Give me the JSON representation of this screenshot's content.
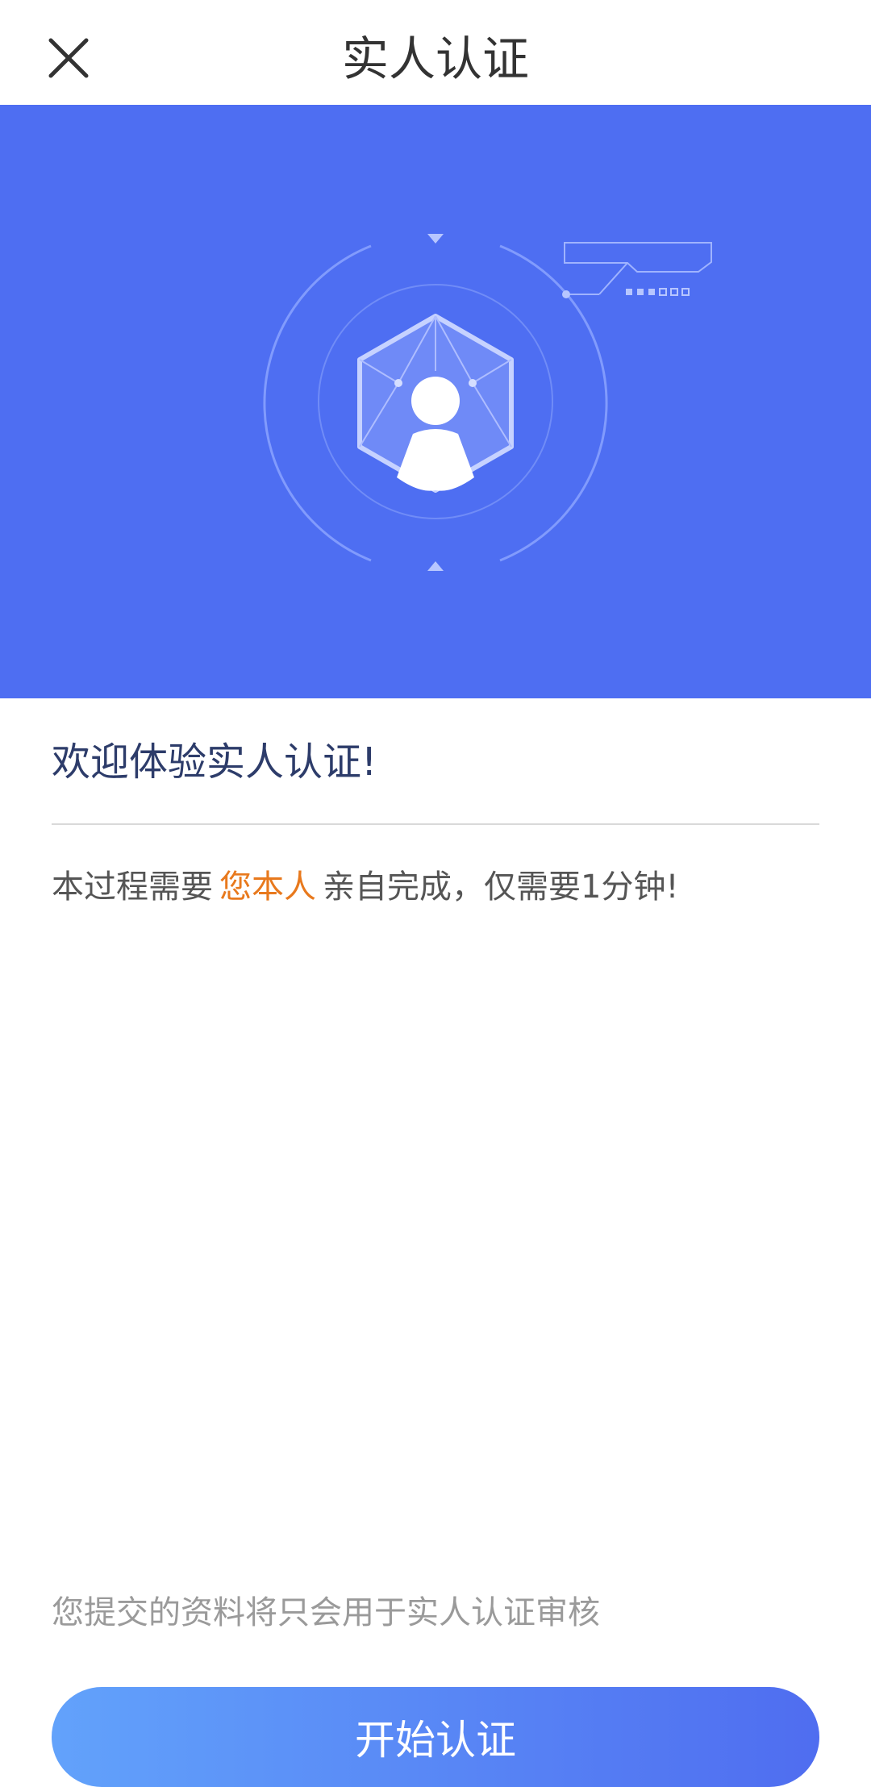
{
  "header": {
    "title": "实人认证",
    "close_icon": "close-icon"
  },
  "banner": {
    "background": "#4e6ef2",
    "illustration_icon": "face-verification-icon"
  },
  "content": {
    "welcome": "欢迎体验实人认证!",
    "desc_prefix": "本过程需要",
    "desc_highlight": "您本人",
    "desc_suffix": "亲自完成，仅需要1分钟!",
    "highlight_color": "#e8791d",
    "footnote": "您提交的资料将只会用于实人认证审核"
  },
  "actions": {
    "start_label": "开始认证"
  }
}
